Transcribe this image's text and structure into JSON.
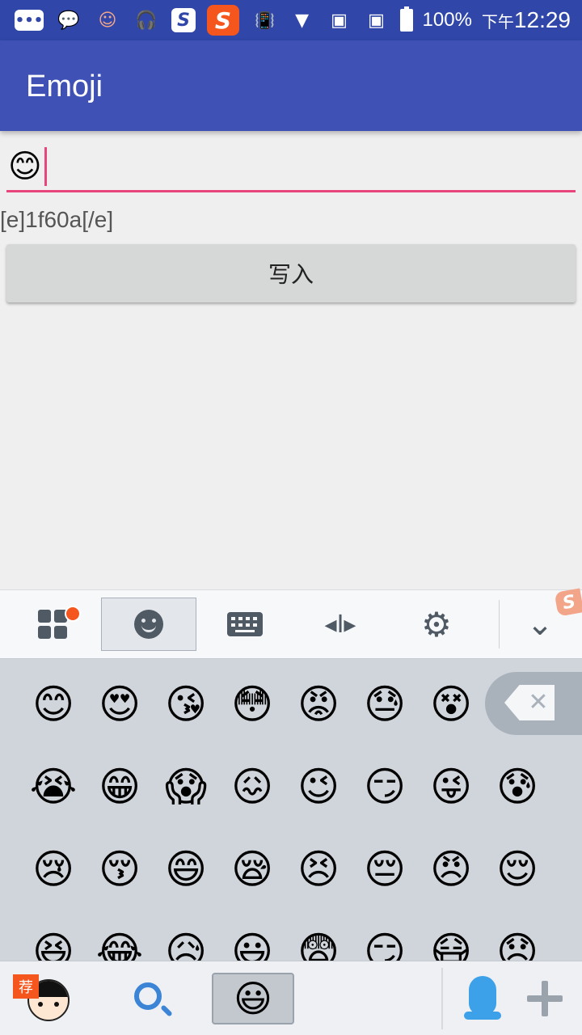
{
  "status_bar": {
    "icons": [
      "message-icon",
      "wechat-icon",
      "cat-face-icon",
      "headset-icon",
      "sogou-s-icon",
      "sogou-red-icon",
      "vibrate-icon",
      "wifi-icon",
      "sim-1-icon",
      "sim-2-icon",
      "battery-icon"
    ],
    "wechat_glyph": "💬",
    "face_glyph": "☺",
    "headset_glyph": "🎧",
    "sogou_letter": "S",
    "vibrate_glyph": "📳",
    "wifi_glyph": "▼",
    "sim_glyph": "▣",
    "battery_percent": "100%",
    "time_prefix": "下午",
    "time": "12:29"
  },
  "app_bar": {
    "title": "Emoji"
  },
  "edit_field": {
    "content_emoji": "😊"
  },
  "code_text": "[e]1f60a[/e]",
  "write_button": {
    "label": "写入"
  },
  "keyboard_toolbar": {
    "items": [
      "apps-grid",
      "emoji",
      "keyboard",
      "cursor-move",
      "settings",
      "collapse"
    ],
    "cursor_glyph": "◂I▸",
    "settings_glyph": "⚙",
    "collapse_glyph": "⌄",
    "corner_letter": "S"
  },
  "emoji_rows": [
    [
      "😊",
      "😍",
      "😘",
      "😳",
      "😡",
      "😓",
      "😵"
    ],
    [
      "😭",
      "😁",
      "😱",
      "😖",
      "😉",
      "😏",
      "😜",
      "😰"
    ],
    [
      "😢",
      "😚",
      "😄",
      "😪",
      "😣",
      "😔",
      "😠",
      "😌"
    ],
    [
      "😆",
      "😂",
      "😥",
      "😃",
      "😨",
      "😏",
      "😷",
      "😞"
    ]
  ],
  "keyboard_bottom": {
    "recommend_badge": "荐",
    "emoji_tab_glyph": "😃"
  },
  "colors": {
    "status_bar": "#3047a9",
    "app_bar": "#3f51b5",
    "accent": "#e8457c",
    "sogou_orange": "#f4561d",
    "search_blue": "#3b84d6",
    "qq_blue": "#3da1ea"
  }
}
